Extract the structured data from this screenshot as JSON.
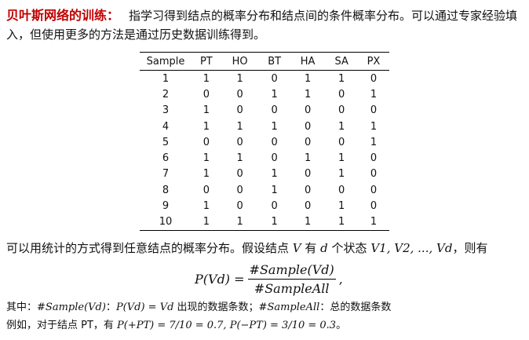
{
  "intro": {
    "heading": "贝叶斯网络的训练：",
    "text": "指学习得到结点的概率分布和结点间的条件概率分布。可以通过专家经验填入，但使用更多的方法是通过历史数据训练得到。"
  },
  "table": {
    "columns": [
      "Sample",
      "PT",
      "HO",
      "BT",
      "HA",
      "SA",
      "PX"
    ],
    "rows": [
      [
        "1",
        "1",
        "1",
        "0",
        "1",
        "1",
        "0"
      ],
      [
        "2",
        "0",
        "0",
        "1",
        "1",
        "0",
        "1"
      ],
      [
        "3",
        "1",
        "0",
        "0",
        "0",
        "0",
        "0"
      ],
      [
        "4",
        "1",
        "1",
        "1",
        "0",
        "1",
        "1"
      ],
      [
        "5",
        "0",
        "0",
        "0",
        "0",
        "0",
        "1"
      ],
      [
        "6",
        "1",
        "1",
        "0",
        "1",
        "1",
        "0"
      ],
      [
        "7",
        "1",
        "0",
        "1",
        "0",
        "1",
        "0"
      ],
      [
        "8",
        "0",
        "0",
        "1",
        "0",
        "0",
        "0"
      ],
      [
        "9",
        "1",
        "0",
        "0",
        "0",
        "1",
        "0"
      ],
      [
        "10",
        "1",
        "1",
        "1",
        "1",
        "1",
        "1"
      ]
    ]
  },
  "paragraph": {
    "part1": "可以用统计的方式得到任意结点的概率分布。假设结点 ",
    "var_v": "V",
    "part2": " 有 ",
    "var_d": "d",
    "part3": " 个状态 ",
    "states": "V1, V2, ..., Vd",
    "part4": "，则有"
  },
  "formula": {
    "lhs": "P(Vd) =",
    "numerator": "#Sample(Vd)",
    "denominator": "#SampleAll",
    "trailing": ","
  },
  "notes": {
    "line1_a": "其中：",
    "line1_b": "#Sample(Vd)",
    "line1_c": "：",
    "line1_d": "P(Vd) = Vd",
    "line1_e": " 出现的数据条数；",
    "line1_f": "#SampleAll",
    "line1_g": "：总的数据条数",
    "line2_a": "例如，对于结点 PT，有 ",
    "line2_b": "P(+PT) = 7/10 = 0.7, P(−PT) = 3/10 = 0.3",
    "line2_c": "。"
  }
}
